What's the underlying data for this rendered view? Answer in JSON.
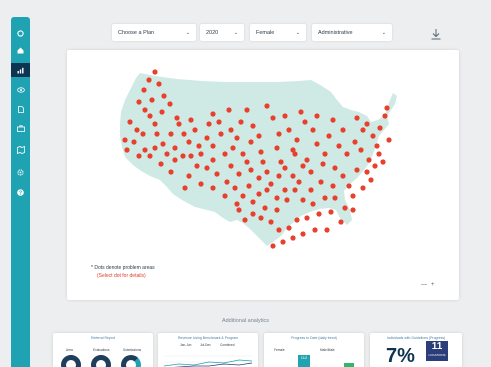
{
  "sidebar": {
    "items": [
      {
        "icon": "circle-icon"
      },
      {
        "icon": "home-icon"
      },
      {
        "icon": "bar-chart-icon"
      },
      {
        "icon": "eye-icon"
      },
      {
        "icon": "document-icon"
      },
      {
        "icon": "briefcase-icon"
      },
      {
        "icon": "map-icon"
      },
      {
        "icon": "gear-icon"
      },
      {
        "icon": "help-icon"
      }
    ],
    "active_index": 2
  },
  "filters": {
    "plan": "Choose a Plan",
    "year": "2020",
    "gender": "Female",
    "category": "Administrative"
  },
  "map": {
    "note": "* Dots denote problem areas",
    "note_sub": "(Select dot for details)",
    "zoom_out": "—",
    "zoom_in": "+",
    "land_color": "#cfe9e4",
    "dot_color": "#e8402c"
  },
  "analytics": {
    "title": "Additional analytics",
    "cards": [
      {
        "title": "Referral Report",
        "labels": [
          "Area",
          "Evaluations",
          "Submissions"
        ]
      },
      {
        "title": "Revenue Using Benchmark & Program",
        "legend": [
          "Jan-Jun",
          "Jul-Dec",
          "Combined"
        ]
      },
      {
        "title": "Progress to Date (daily trend)",
        "labels": [
          "Female",
          "Male/Male"
        ],
        "value": "112"
      },
      {
        "title": "Individuals with Guidelines (Progress)",
        "percent": "7%",
        "locations_count": "11",
        "locations_label": "LOCATIONS"
      }
    ]
  }
}
